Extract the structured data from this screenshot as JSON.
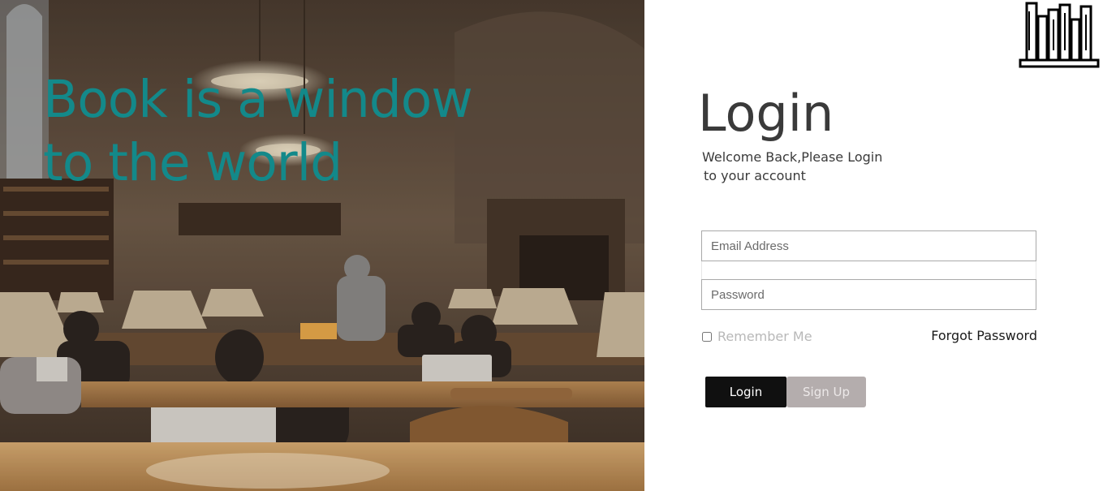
{
  "hero": {
    "tagline_line1": "Book is a window",
    "tagline_line2": "to the world",
    "tagline_color": "#13898a"
  },
  "logo": {
    "icon": "bookshelf-icon"
  },
  "login": {
    "title": "Login",
    "welcome_line1": "Welcome Back,Please Login",
    "welcome_line2": "to your account",
    "email_placeholder": "Email Address",
    "email_value": "",
    "password_placeholder": "Password",
    "password_value": "",
    "remember_label": "Remember Me",
    "remember_checked": false,
    "forgot_label": "Forgot Password",
    "login_button": "Login",
    "signup_button": "Sign Up"
  },
  "colors": {
    "login_button_bg": "#101010",
    "signup_button_bg": "#b4adad",
    "title_text": "#3a3a3a"
  }
}
